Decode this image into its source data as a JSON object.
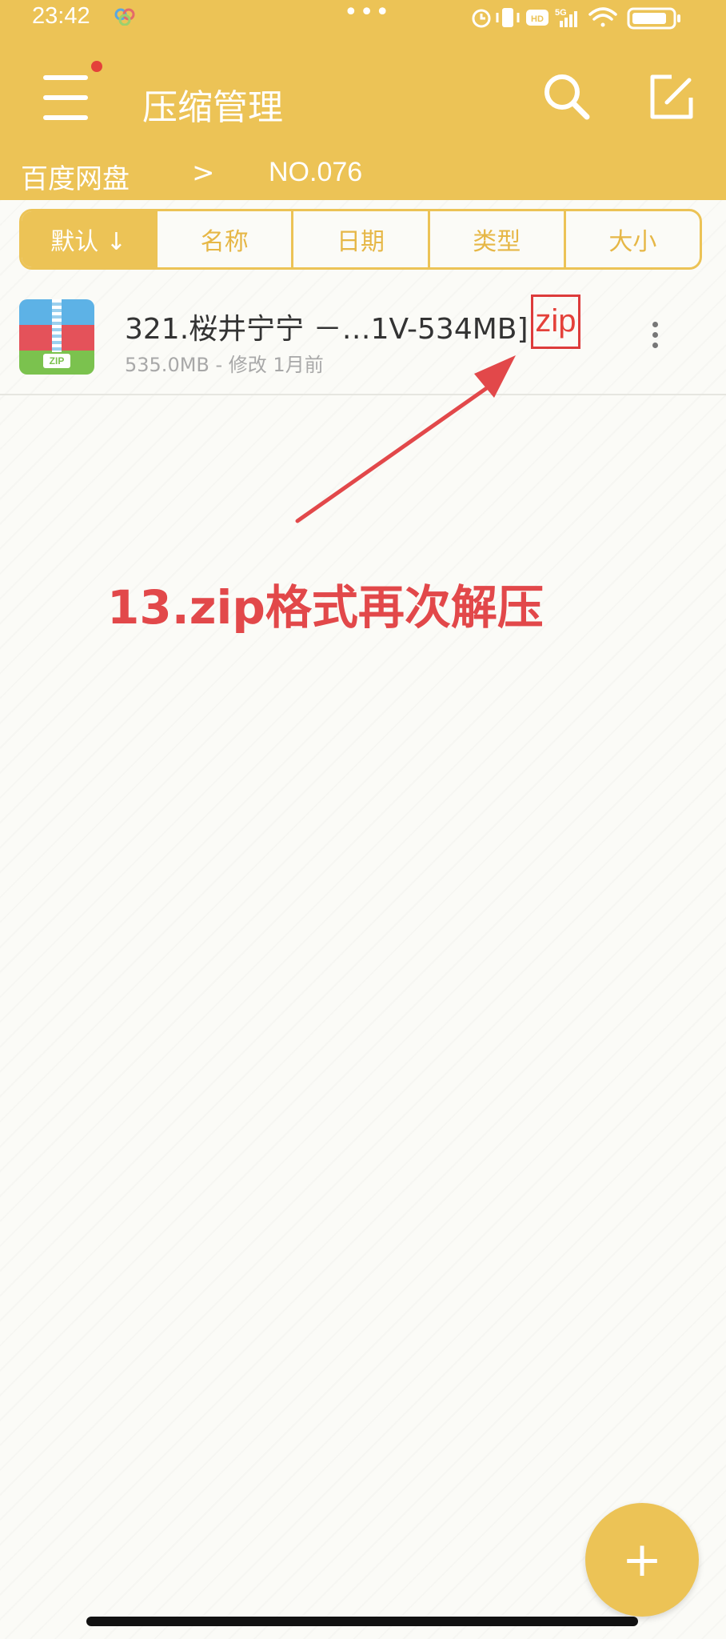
{
  "status_bar": {
    "time": "23:42",
    "dots": "•••",
    "icons": [
      "alarm-icon",
      "vibrate-icon",
      "hd-icon",
      "5g-signal-icon",
      "wifi-icon",
      "battery-icon"
    ]
  },
  "app_bar": {
    "title": "压缩管理",
    "accent_color": "#ecc356",
    "menu_notification_color": "#e4413a"
  },
  "breadcrumb": {
    "root": "百度网盘",
    "separator": ">",
    "current": "NO.076"
  },
  "sort_tabs": [
    {
      "label": "默认 ↓",
      "active": true
    },
    {
      "label": "名称",
      "active": false
    },
    {
      "label": "日期",
      "active": false
    },
    {
      "label": "类型",
      "active": false
    },
    {
      "label": "大小",
      "active": false
    }
  ],
  "files": [
    {
      "name": "321.桜井宁宁 －…1V-534MB]",
      "ext": "zip",
      "meta": "535.0MB - 修改 1月前",
      "icon": "zip-archive-icon"
    }
  ],
  "annotation": {
    "text": "13.zip格式再次解压",
    "color": "#e2484a"
  },
  "fab": {
    "label": "+"
  }
}
